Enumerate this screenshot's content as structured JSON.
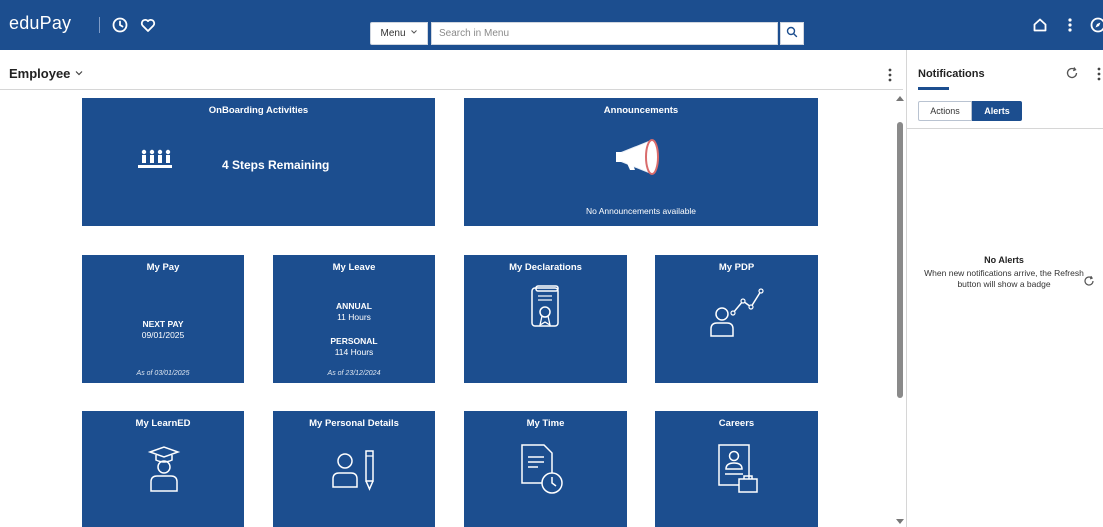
{
  "header": {
    "brand": "eduPay",
    "menu_label": "Menu",
    "search_placeholder": "Search in Menu"
  },
  "page": {
    "title": "Employee"
  },
  "tiles": {
    "onboarding": {
      "title": "OnBoarding Activities",
      "text": "4 Steps Remaining"
    },
    "announcements": {
      "title": "Announcements",
      "text": "No Announcements available"
    },
    "my_pay": {
      "title": "My Pay",
      "line1": "NEXT PAY",
      "line2": "09/01/2025",
      "footer": "As of 03/01/2025"
    },
    "my_leave": {
      "title": "My Leave",
      "annual_label": "ANNUAL",
      "annual_value": "11 Hours",
      "personal_label": "PERSONAL",
      "personal_value": "114 Hours",
      "footer": "As of 23/12/2024"
    },
    "my_declarations": {
      "title": "My Declarations"
    },
    "my_pdp": {
      "title": "My PDP"
    },
    "my_learned": {
      "title": "My LearnED"
    },
    "my_personal_details": {
      "title": "My Personal Details"
    },
    "my_time": {
      "title": "My Time"
    },
    "careers": {
      "title": "Careers"
    }
  },
  "notifications": {
    "title": "Notifications",
    "tabs": [
      "Actions",
      "Alerts"
    ],
    "active_tab": "Alerts",
    "empty_title": "No Alerts",
    "empty_message": "When new notifications arrive, the Refresh button will show a badge"
  },
  "colors": {
    "brand_blue": "#1c4e8f",
    "tile_blue": "#1c4e8f"
  },
  "icons": [
    "history-icon",
    "favorites-icon",
    "search-icon",
    "home-icon",
    "more-options-icon",
    "navbar-icon",
    "refresh-icon",
    "chevron-down-icon"
  ]
}
